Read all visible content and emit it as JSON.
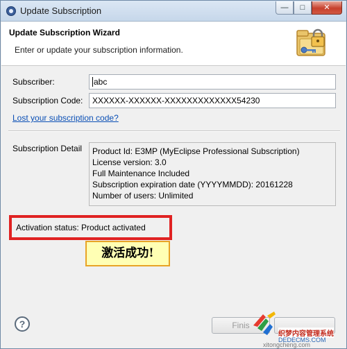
{
  "window": {
    "title": "Update Subscription",
    "minimize_glyph": "—",
    "maximize_glyph": "□",
    "close_glyph": "✕"
  },
  "header": {
    "title": "Update Subscription Wizard",
    "description": "Enter or update your subscription information.",
    "icon": "folder-lock-key-icon"
  },
  "form": {
    "subscriber_label": "Subscriber:",
    "subscriber_value": "abc",
    "code_label": "Subscription Code:",
    "code_value": "XXXXXX-XXXXXX-XXXXXXXXXXXXX54230",
    "lost_code_link": "Lost your subscription code?"
  },
  "detail": {
    "label": "Subscription Detail",
    "lines": [
      "Product Id: E3MP (MyEclipse Professional Subscription)",
      "License version: 3.0",
      "Full Maintenance Included",
      "Subscription expiration date (YYYYMMDD): 20161228",
      "Number of users: Unlimited"
    ]
  },
  "status": {
    "text": "Activation status: Product activated",
    "highlight_color": "#e02222"
  },
  "callout": {
    "text": "激活成功!",
    "background": "#ffffb4",
    "border": "#e8a326"
  },
  "footer": {
    "help_glyph": "?",
    "finish_label": "Finis",
    "watermark_line1": "织梦内容管理系统",
    "watermark_line2": "DEDECMS.COM",
    "watermark_line3": "xitongcheng.com"
  },
  "colors": {
    "link": "#0a4fb5",
    "titlebar": "#c6d7ea"
  }
}
